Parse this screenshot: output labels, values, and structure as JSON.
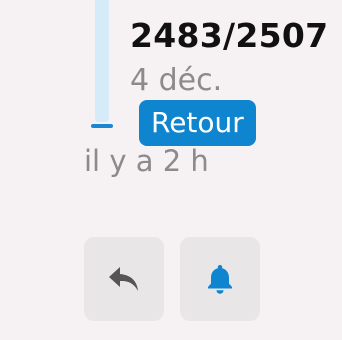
{
  "progress": {
    "current": 2483,
    "total": 2507,
    "label": "2483/2507",
    "fraction": 0.99
  },
  "date_label": "4 déc.",
  "status_badge": "Retour",
  "time_ago": "il y a 2 h",
  "actions": {
    "reply_icon": "reply-icon",
    "bell_icon": "bell-icon"
  },
  "colors": {
    "accent": "#0f85cf",
    "track": "#d6ebf8",
    "background": "#f6f1f3",
    "muted_text": "#8b8b8b",
    "reply_icon": "#555555"
  }
}
